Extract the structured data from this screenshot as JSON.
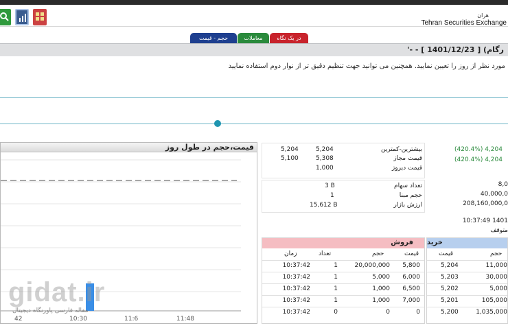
{
  "header": {
    "brand_fa": "هران",
    "brand_en": "Tehran Securities Exchange"
  },
  "tabs": [
    "در یک نگاه",
    "معاملات",
    "حجم - قیمت"
  ],
  "title": "رگام) [ 1401/12/23 ] - -'",
  "instruction": "مورد نظر از روز را تعیین نمایید. همچنین می توانید جهت تنظیم دقیق تر از نوار دوم استفاده نمایید",
  "chart_data": {
    "type": "bar",
    "title": "قیمت،حجم در طول روز",
    "x_ticks": [
      "42",
      "10:30",
      "11:6",
      "11:48"
    ],
    "bars": [
      {
        "x": "10:37:42",
        "value": 1
      }
    ]
  },
  "summary": {
    "rows1": [
      {
        "label": "بیشترین-کمترین",
        "v1": "5,204",
        "v2": "5,204"
      },
      {
        "label": "قیمت مجاز",
        "v1": "5,308",
        "v2": "5,100"
      },
      {
        "label": "قیمت دیروز",
        "v1": "1,000",
        "v2": ""
      }
    ],
    "rows2": [
      {
        "label": "تعداد سهام",
        "v1": "3 B"
      },
      {
        "label": "حجم مبنا",
        "v1": "1"
      },
      {
        "label": "ارزش بازار",
        "v1": "15,612 B"
      }
    ]
  },
  "right": {
    "g1": "(420.4%) 4,204",
    "g2": "(420.4%) 4,204",
    "r1": "8,0",
    "r2": "40,000,0",
    "r3": "208,160,000,0",
    "time": "10:37:49 1401",
    "status": "متوقف"
  },
  "sell": {
    "title": "فروش",
    "headers": {
      "price": "قیمت",
      "volume": "حجم",
      "count": "تعداد",
      "time": "زمان"
    },
    "rows": [
      {
        "price": "5,800",
        "volume": "20,000,000",
        "count": "1",
        "time": "10:37:42"
      },
      {
        "price": "6,000",
        "volume": "5,000",
        "count": "1",
        "time": "10:37:42"
      },
      {
        "price": "6,500",
        "volume": "1,000",
        "count": "1",
        "time": "10:37:42"
      },
      {
        "price": "7,000",
        "volume": "1,000",
        "count": "1",
        "time": "10:37:42"
      },
      {
        "price": "0",
        "volume": "0",
        "count": "0",
        "time": "10:37:42"
      }
    ]
  },
  "buy": {
    "title": "خرید",
    "headers": {
      "price": "قیمت",
      "volume": "حجم"
    },
    "rows": [
      {
        "price": "5,204",
        "volume": "11,000"
      },
      {
        "price": "5,203",
        "volume": "30,000"
      },
      {
        "price": "5,202",
        "volume": "5,000"
      },
      {
        "price": "5,201",
        "volume": "105,000"
      },
      {
        "price": "5,200",
        "volume": "1,035,000"
      }
    ]
  },
  "watermark": {
    "big": "gidat.ir",
    "small": "مقاله فارسی پاورنگاه دیجیتال"
  },
  "colors": {
    "sell": "#f5bdc2",
    "buy": "#b7cfee",
    "green": "#2a8a3c",
    "bar": "#3a8ee6"
  }
}
